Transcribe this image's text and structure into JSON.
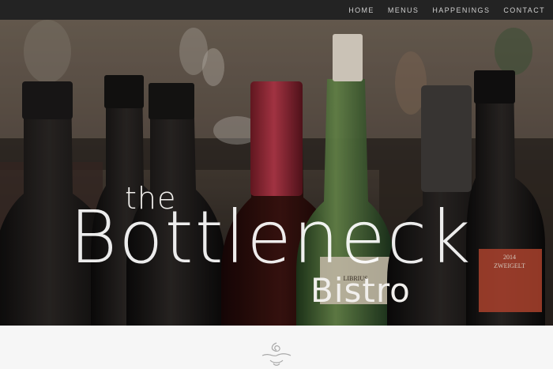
{
  "nav": {
    "items": [
      "HOME",
      "MENUS",
      "HAPPENINGS",
      "CONTACT"
    ]
  },
  "hero": {
    "logo_the": "the",
    "logo_bottleneck": "Bottleneck",
    "logo_bistro": "Bistro",
    "label_left": "LIBRIUS",
    "label_right_year": "2014",
    "label_right_name": "ZWEIGELT"
  },
  "colors": {
    "topbar": "#232323",
    "nav_text": "#cfcfcf",
    "page_bg": "#f6f6f6",
    "logo": "#f1efec"
  },
  "icons": [
    "flourish-ornament-icon"
  ]
}
